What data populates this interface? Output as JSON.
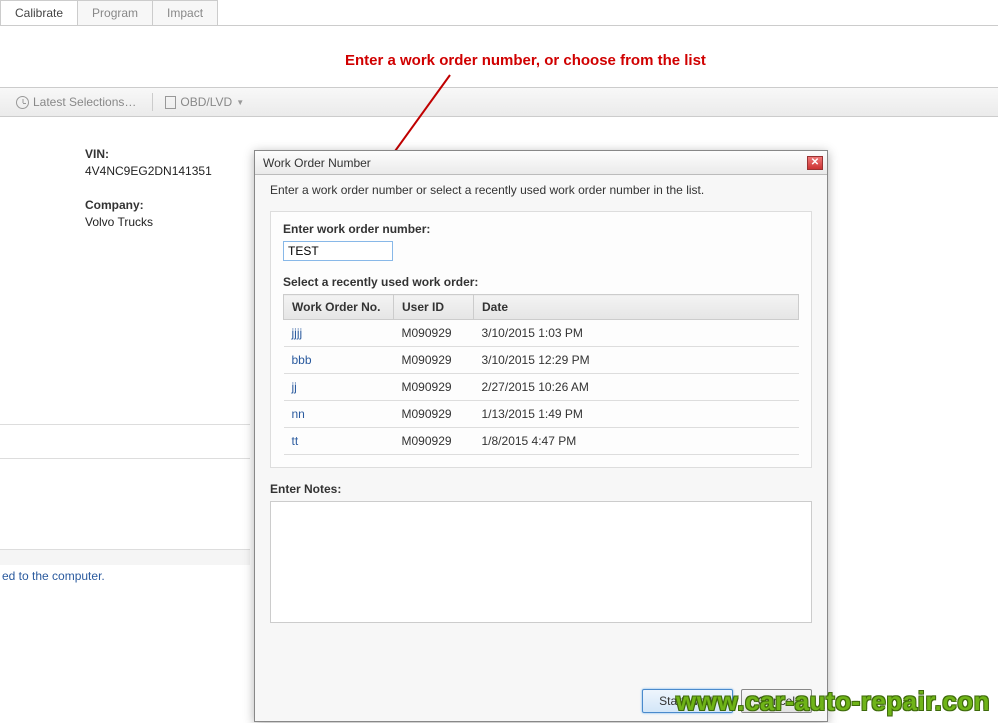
{
  "tabs": {
    "calibrate": "Calibrate",
    "program": "Program",
    "impact": "Impact"
  },
  "annotation": "Enter a work order number,  or choose from the list",
  "toolbar": {
    "latest": "Latest Selections…",
    "obd": "OBD/LVD"
  },
  "info": {
    "vin_label": "VIN:",
    "vin_value": "4V4NC9EG2DN141351",
    "company_label": "Company:",
    "company_value": "Volvo Trucks"
  },
  "status_text": "ed to the computer.",
  "dialog": {
    "title": "Work Order Number",
    "instruction": "Enter a work order number or select a recently used work order number in the list.",
    "enter_label": "Enter work order number:",
    "input_value": "TEST",
    "recent_label": "Select a recently used work order:",
    "cols": {
      "c0": "Work Order No.",
      "c1": "User ID",
      "c2": "Date"
    },
    "rows": [
      {
        "wo": "jjjj",
        "uid": "M090929",
        "date": "3/10/2015 1:03 PM"
      },
      {
        "wo": "bbb",
        "uid": "M090929",
        "date": "3/10/2015 12:29 PM"
      },
      {
        "wo": "jj",
        "uid": "M090929",
        "date": "2/27/2015 10:26 AM"
      },
      {
        "wo": "nn",
        "uid": "M090929",
        "date": "1/13/2015 1:49 PM"
      },
      {
        "wo": "tt",
        "uid": "M090929",
        "date": "1/8/2015 4:47 PM"
      }
    ],
    "notes_label": "Enter Notes:",
    "start": "Start Work",
    "cancel": "Cancel"
  },
  "watermark": "www.car-auto-repair.con"
}
